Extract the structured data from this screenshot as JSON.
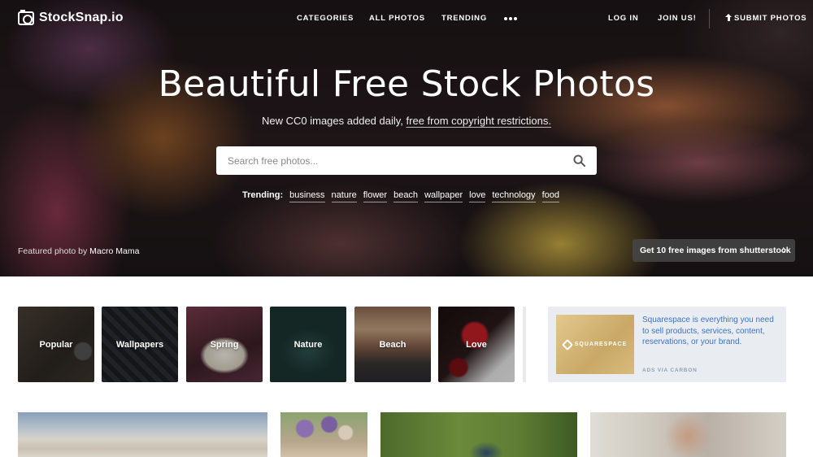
{
  "brand": {
    "name": "StockSnap.io"
  },
  "nav": {
    "links": [
      "CATEGORIES",
      "ALL PHOTOS",
      "TRENDING"
    ],
    "login": "LOG IN",
    "join": "JOIN US!",
    "submit": "SUBMIT PHOTOS"
  },
  "hero": {
    "title": "Beautiful Free Stock Photos",
    "subtitle_prefix": "New CC0 images added daily,",
    "subtitle_link": "free from copyright restrictions.",
    "search_placeholder": "Search free photos...",
    "trending_label": "Trending:",
    "trending_tags": [
      "business",
      "nature",
      "flower",
      "beach",
      "wallpaper",
      "love",
      "technology",
      "food"
    ],
    "featured_prefix": "Featured photo by",
    "featured_author": "Macro Mama",
    "shutterstock_button": "Get 10 free images from shutterstock"
  },
  "categories": [
    "Popular",
    "Wallpapers",
    "Spring",
    "Nature",
    "Beach",
    "Love"
  ],
  "ad": {
    "logo_text": "SQUARESPACE",
    "text": "Squarespace is everything you need to sell products, services, content, reservations, or your brand.",
    "via": "ADS VIA CARBON"
  }
}
